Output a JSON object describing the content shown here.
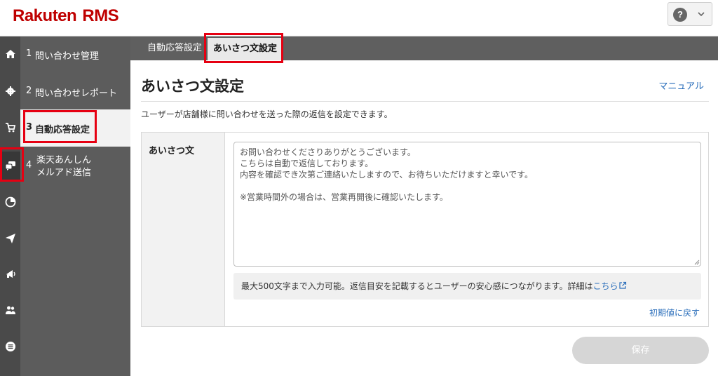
{
  "header": {
    "logo_word": "Rakuten",
    "logo_suffix": "RMS",
    "help_icon_text": "?"
  },
  "sidebar": {
    "items": [
      {
        "num": "1",
        "label": "問い合わせ管理"
      },
      {
        "num": "2",
        "label": "問い合わせレポート"
      },
      {
        "num": "3",
        "label": "自動応答設定"
      },
      {
        "num": "4",
        "label_line1": "楽天あんしん",
        "label_line2": "メルアド送信"
      }
    ]
  },
  "tabs": [
    {
      "label": "自動応答設定"
    },
    {
      "label": "あいさつ文設定"
    }
  ],
  "content": {
    "title": "あいさつ文設定",
    "manual_link": "マニュアル",
    "description": "ユーザーが店舗様に問い合わせを送った際の返信を設定できます。",
    "field_label": "あいさつ文",
    "message": "お問い合わせくださりありがとうございます。\nこちらは自動で返信しております。\n内容を確認でき次第ご連絡いたしますので、お待ちいただけますと幸いです。\n\n※営業時間外の場合は、営業再開後に確認いたします。",
    "note_text": "最大500文字まで入力可能。返信目安を記載するとユーザーの安心感につながります。詳細は",
    "note_link": "こちら",
    "reset_link": "初期値に戻す",
    "save_button": "保存"
  },
  "colors": {
    "brand": "#bf0000",
    "highlight": "#e60012",
    "link": "#2a6ebb"
  }
}
